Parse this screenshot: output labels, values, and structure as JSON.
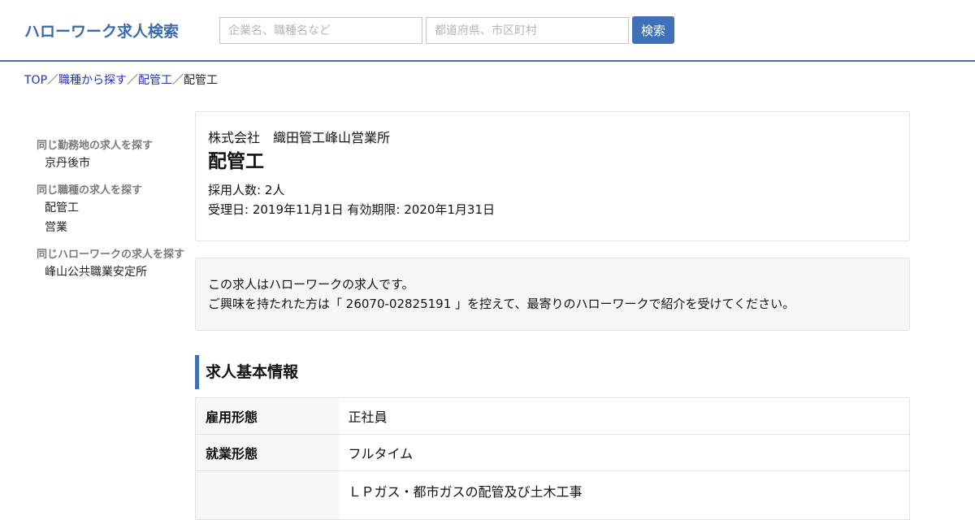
{
  "header": {
    "logo": "ハローワーク求人検索",
    "keyword_placeholder": "企業名、職種名など",
    "location_placeholder": "都道府県、市区町村",
    "search_label": "検索"
  },
  "breadcrumb": {
    "items": [
      "TOP",
      "職種から探す",
      "配管工",
      "配管工"
    ],
    "separator": "／"
  },
  "sidebar": {
    "groups": [
      {
        "heading": "同じ勤務地の求人を探す",
        "links": [
          "京丹後市"
        ]
      },
      {
        "heading": "同じ職種の求人を探す",
        "links": [
          "配管工",
          "営業"
        ]
      },
      {
        "heading": "同じハローワークの求人を探す",
        "links": [
          "峰山公共職業安定所"
        ]
      }
    ]
  },
  "job": {
    "company": "株式会社　織田管工峰山営業所",
    "title": "配管工",
    "hires": "採用人数: 2人",
    "dates": "受理日: 2019年11月1日 有効期限: 2020年1月31日"
  },
  "notice": {
    "line1": "この求人はハローワークの求人です。",
    "line2": "ご興味を持たれた方は「 26070-02825191 」を控えて、最寄りのハローワークで紹介を受けてください。"
  },
  "basic_info": {
    "title": "求人基本情報",
    "rows": [
      {
        "key": "雇用形態",
        "value": "正社員"
      },
      {
        "key": "就業形態",
        "value": "フルタイム"
      },
      {
        "key": "",
        "value": "ＬＰガス・都市ガスの配管及び土木工事"
      }
    ]
  },
  "colors": {
    "accent": "#3f70b8",
    "logo": "#3d6aa8",
    "link": "#2233bb"
  }
}
